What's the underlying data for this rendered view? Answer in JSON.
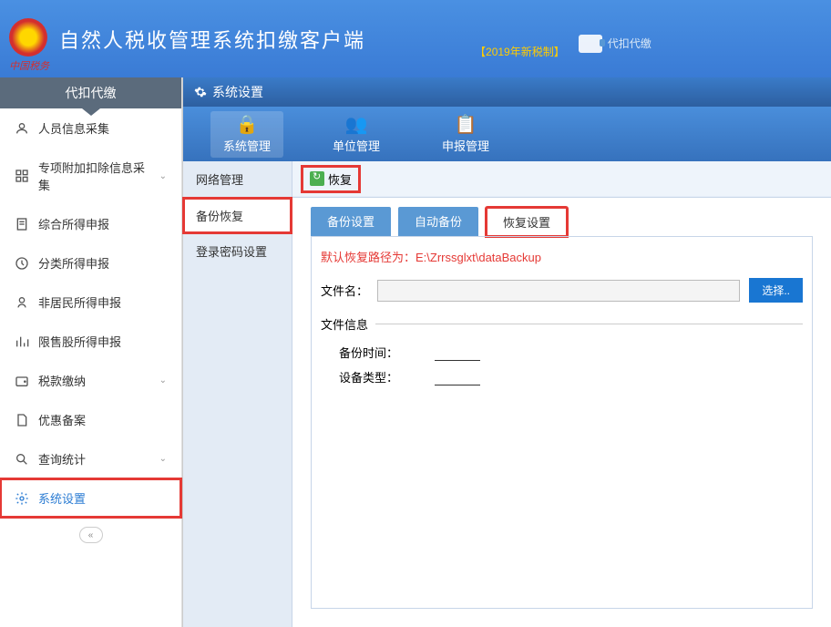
{
  "header": {
    "title": "自然人税收管理系统扣缴客户端",
    "subtitle": "【2019年新税制】",
    "mode_label": "代扣代缴",
    "sub_logo": "中国税务"
  },
  "sidebar": {
    "header": "代扣代缴",
    "items": [
      {
        "label": "人员信息采集",
        "icon": "person",
        "expand": false
      },
      {
        "label": "专项附加扣除信息采集",
        "icon": "grid",
        "expand": true
      },
      {
        "label": "综合所得申报",
        "icon": "doc",
        "expand": false
      },
      {
        "label": "分类所得申报",
        "icon": "clock",
        "expand": false
      },
      {
        "label": "非居民所得申报",
        "icon": "person2",
        "expand": false
      },
      {
        "label": "限售股所得申报",
        "icon": "chart",
        "expand": false
      },
      {
        "label": "税款缴纳",
        "icon": "wallet",
        "expand": true
      },
      {
        "label": "优惠备案",
        "icon": "file",
        "expand": false
      },
      {
        "label": "查询统计",
        "icon": "search",
        "expand": true
      },
      {
        "label": "系统设置",
        "icon": "gear",
        "expand": false,
        "active": true,
        "highlight": true
      }
    ]
  },
  "window": {
    "title": "系统设置",
    "top_tabs": [
      {
        "label": "系统管理",
        "icon": "lock",
        "active": true
      },
      {
        "label": "单位管理",
        "icon": "users"
      },
      {
        "label": "申报管理",
        "icon": "form"
      }
    ],
    "left_nav": [
      {
        "label": "网络管理"
      },
      {
        "label": "备份恢复",
        "active": true,
        "highlight": true
      },
      {
        "label": "登录密码设置"
      }
    ],
    "toolbar": {
      "restore_label": "恢复",
      "highlight": true
    },
    "inner_tabs": [
      {
        "label": "备份设置"
      },
      {
        "label": "自动备份"
      },
      {
        "label": "恢复设置",
        "active": true,
        "highlight": true
      }
    ],
    "form": {
      "default_path_text": "默认恢复路径为：E:\\Zrrssglxt\\dataBackup",
      "filename_label": "文件名：",
      "filename_value": "",
      "select_btn": "选择..",
      "file_info_title": "文件信息",
      "backup_time_label": "备份时间：",
      "backup_time_value": "",
      "device_type_label": "设备类型：",
      "device_type_value": ""
    }
  }
}
